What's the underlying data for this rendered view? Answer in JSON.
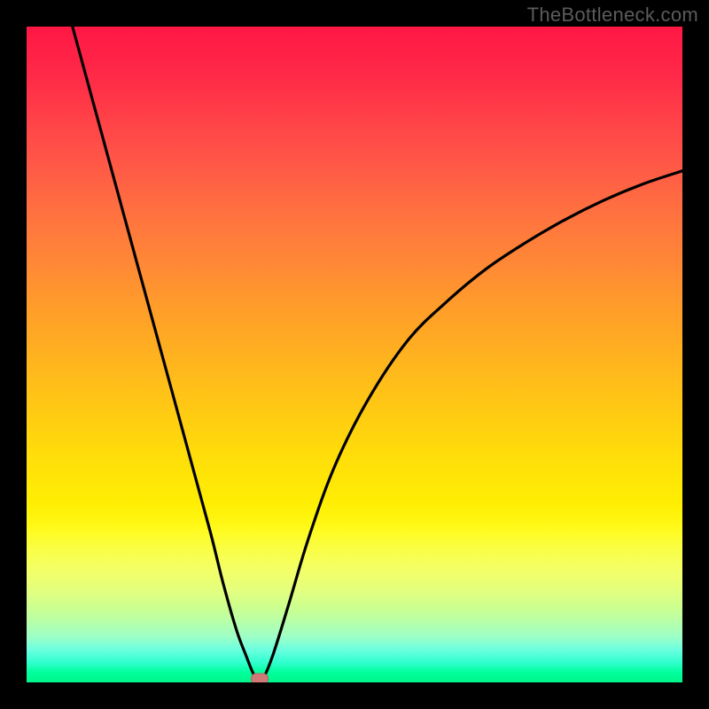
{
  "watermark": "TheBottleneck.com",
  "chart_data": {
    "type": "line",
    "title": "",
    "xlabel": "",
    "ylabel": "",
    "xlim": [
      0,
      100
    ],
    "ylim": [
      0,
      100
    ],
    "grid": false,
    "legend": false,
    "background_gradient_stops": [
      {
        "pos": 0,
        "color": "#ff1744"
      },
      {
        "pos": 14,
        "color": "#ff4148"
      },
      {
        "pos": 28,
        "color": "#ff7040"
      },
      {
        "pos": 44,
        "color": "#ffa028"
      },
      {
        "pos": 58,
        "color": "#ffc814"
      },
      {
        "pos": 73,
        "color": "#ffef04"
      },
      {
        "pos": 84,
        "color": "#ebff55"
      },
      {
        "pos": 93,
        "color": "#9dffc6"
      },
      {
        "pos": 100,
        "color": "#00f58a"
      }
    ],
    "series": [
      {
        "name": "bottleneck-curve-left",
        "type": "line",
        "stroke": "#000000",
        "x": [
          7.0,
          10.0,
          13.0,
          16.0,
          19.0,
          22.0,
          25.0,
          28.0,
          30.0,
          32.0,
          33.5,
          34.5,
          35.2
        ],
        "y": [
          100.0,
          89.0,
          78.0,
          67.0,
          56.0,
          45.0,
          34.0,
          23.0,
          15.0,
          8.0,
          4.0,
          1.5,
          0.5
        ]
      },
      {
        "name": "bottleneck-curve-right",
        "type": "line",
        "stroke": "#000000",
        "x": [
          36.0,
          37.5,
          40.0,
          43.0,
          47.0,
          52.0,
          58.0,
          64.0,
          70.0,
          76.0,
          82.0,
          88.0,
          94.0,
          100.0
        ],
        "y": [
          0.5,
          4.0,
          12.0,
          22.0,
          33.0,
          43.0,
          52.0,
          58.0,
          63.0,
          67.0,
          70.5,
          73.5,
          76.0,
          78.0
        ]
      }
    ],
    "marker": {
      "x": 35.5,
      "y": 0,
      "shape": "capsule",
      "color": "#cf7a77"
    }
  }
}
